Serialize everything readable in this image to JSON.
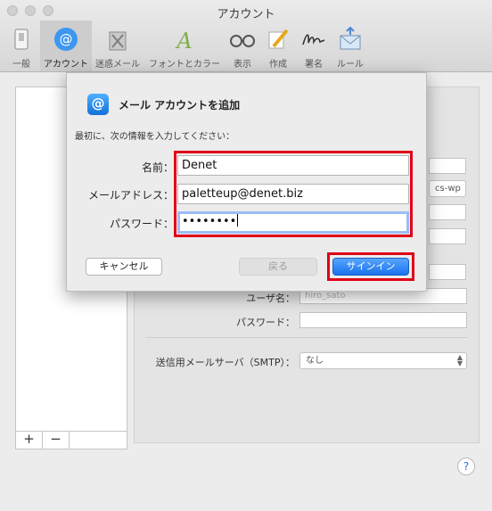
{
  "window": {
    "title": "アカウント"
  },
  "toolbar": {
    "items": [
      {
        "label": "一般",
        "icon": "switch-icon"
      },
      {
        "label": "アカウント",
        "icon": "at-sign-icon",
        "selected": true
      },
      {
        "label": "迷惑メール",
        "icon": "trash-bin-icon"
      },
      {
        "label": "フォントとカラー",
        "icon": "font-a-icon"
      },
      {
        "label": "表示",
        "icon": "glasses-icon"
      },
      {
        "label": "作成",
        "icon": "pencil-icon"
      },
      {
        "label": "署名",
        "icon": "signature-icon"
      },
      {
        "label": "ルール",
        "icon": "envelope-rules-icon"
      }
    ]
  },
  "list_buttons": {
    "add": "+",
    "remove": "−"
  },
  "background": {
    "select_text": "cs-wp",
    "user_label": "ユーザ名：",
    "user_value": "hiro_sato",
    "password_label": "パスワード：",
    "smtp_label": "送信用メールサーバ（SMTP）：",
    "smtp_value": "なし",
    "help": "?"
  },
  "sheet": {
    "title": "メール アカウントを追加",
    "description": "最初に、次の情報を入力してください：",
    "name_label": "名前：",
    "name_value": "Denet",
    "email_label": "メールアドレス：",
    "email_value": "paletteup@denet.biz",
    "password_label": "パスワード：",
    "password_value": "••••••••",
    "cancel_label": "キャンセル",
    "back_label": "戻る",
    "signin_label": "サインイン"
  },
  "colors": {
    "accent": "#1a73ec",
    "highlight": "#e00018"
  }
}
